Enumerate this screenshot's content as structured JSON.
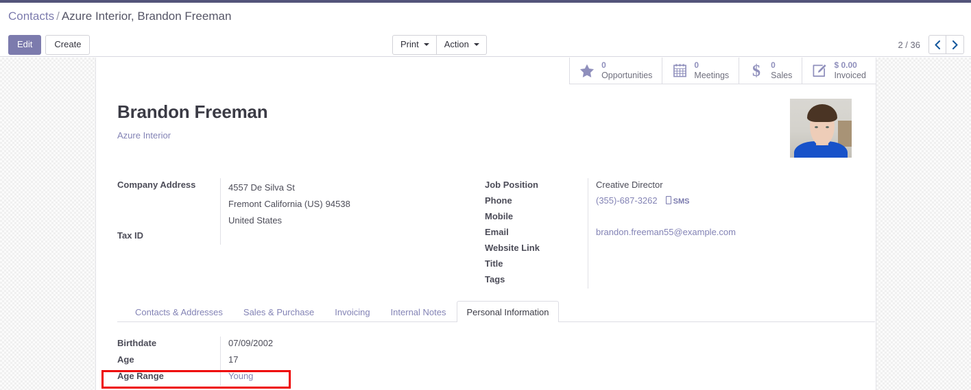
{
  "breadcrumb": {
    "root": "Contacts",
    "separator": "/",
    "current": "Azure Interior, Brandon Freeman"
  },
  "toolbar": {
    "edit_label": "Edit",
    "create_label": "Create",
    "print_label": "Print",
    "action_label": "Action"
  },
  "pager": {
    "count": "2 / 36",
    "prev_icon": "chevron-left-icon",
    "next_icon": "chevron-right-icon"
  },
  "stat_buttons": [
    {
      "icon": "star-icon",
      "value": "0",
      "label": "Opportunities"
    },
    {
      "icon": "calendar-icon",
      "value": "0",
      "label": "Meetings"
    },
    {
      "icon": "dollar-icon",
      "value": "0",
      "label": "Sales"
    },
    {
      "icon": "pencil-square-icon",
      "value": "$ 0.00",
      "label": "Invoiced"
    }
  ],
  "record": {
    "name": "Brandon Freeman",
    "company": "Azure Interior",
    "avatar_alt": "contact-photo"
  },
  "left_group": {
    "address_label": "Company Address",
    "address_street": "4557 De Silva St",
    "address_city": "Fremont",
    "address_state": "California (US)",
    "address_zip": "94538",
    "address_country": "United States",
    "taxid_label": "Tax ID",
    "taxid_value": ""
  },
  "right_group": {
    "job_label": "Job Position",
    "job_value": "Creative Director",
    "phone_label": "Phone",
    "phone_value": "(355)-687-3262",
    "sms_label": "SMS",
    "mobile_label": "Mobile",
    "mobile_value": "",
    "email_label": "Email",
    "email_value": "brandon.freeman55@example.com",
    "website_label": "Website Link",
    "website_value": "",
    "title_label": "Title",
    "title_value": "",
    "tags_label": "Tags",
    "tags_value": ""
  },
  "tabs": [
    {
      "label": "Contacts & Addresses",
      "active": false
    },
    {
      "label": "Sales & Purchase",
      "active": false
    },
    {
      "label": "Invoicing",
      "active": false
    },
    {
      "label": "Internal Notes",
      "active": false
    },
    {
      "label": "Personal Information",
      "active": true
    }
  ],
  "personal_information": {
    "birthdate_label": "Birthdate",
    "birthdate_value": "07/09/2002",
    "age_label": "Age",
    "age_value": "17",
    "age_range_label": "Age Range",
    "age_range_value": "Young"
  },
  "colors": {
    "primary_purple": "#7c7bad",
    "link_purple": "#8383b5",
    "stat_purple": "#8f8fbc",
    "annotation_red": "#ee0000",
    "navbar": "#53547a"
  }
}
